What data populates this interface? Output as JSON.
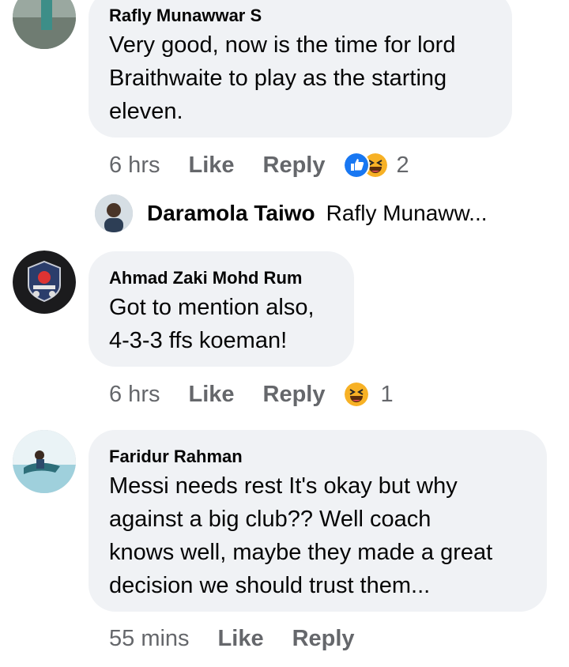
{
  "comments": [
    {
      "author": "Rafly Munawwar S",
      "lines": [
        "Very good, now is the time for lord",
        "Braithwaite to play as the starting",
        "eleven."
      ],
      "time": "6 hrs",
      "like_label": "Like",
      "reply_label": "Reply",
      "reaction_count": "2",
      "reactions": [
        "like-icon",
        "laugh-icon"
      ]
    },
    {
      "author": "Ahmad Zaki Mohd Rum",
      "lines": [
        "Got to mention also,",
        "4-3-3 ffs koeman!"
      ],
      "time": "6 hrs",
      "like_label": "Like",
      "reply_label": "Reply",
      "reaction_count": "1",
      "reactions": [
        "laugh-icon"
      ]
    },
    {
      "author": "Faridur Rahman",
      "lines": [
        "Messi needs rest It's okay but why",
        "against a big club?? Well coach",
        "knows well, maybe they made a great",
        "decision we should trust them..."
      ],
      "time": "55 mins",
      "like_label": "Like",
      "reply_label": "Reply"
    }
  ],
  "reply_preview": {
    "name": "Daramola Taiwo",
    "snippet": "Rafly Munaww..."
  },
  "colors": {
    "bubble": "#f0f2f5",
    "meta": "#65676b",
    "like_blue": "#1877f2",
    "laugh_yellow": "#f7b125"
  }
}
